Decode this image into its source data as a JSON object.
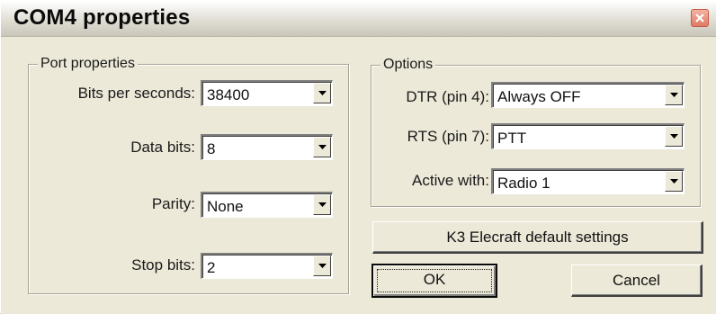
{
  "window": {
    "title": "COM4 properties"
  },
  "port_properties": {
    "group_label": "Port properties",
    "bits_per_second": {
      "label": "Bits per seconds:",
      "value": "38400"
    },
    "data_bits": {
      "label": "Data bits:",
      "value": "8"
    },
    "parity": {
      "label": "Parity:",
      "value": "None"
    },
    "stop_bits": {
      "label": "Stop bits:",
      "value": "2"
    }
  },
  "options": {
    "group_label": "Options",
    "dtr": {
      "label": "DTR (pin 4):",
      "value": "Always OFF"
    },
    "rts": {
      "label": "RTS (pin 7):",
      "value": "PTT"
    },
    "active_with": {
      "label": "Active with:",
      "value": "Radio 1"
    }
  },
  "buttons": {
    "defaults": "K3 Elecraft default settings",
    "ok": "OK",
    "cancel": "Cancel"
  },
  "icons": {
    "close": "close-icon",
    "dropdown": "chevron-down-icon"
  },
  "colors": {
    "close_button": "#e07a63",
    "dialog_face": "#ece9d8"
  }
}
